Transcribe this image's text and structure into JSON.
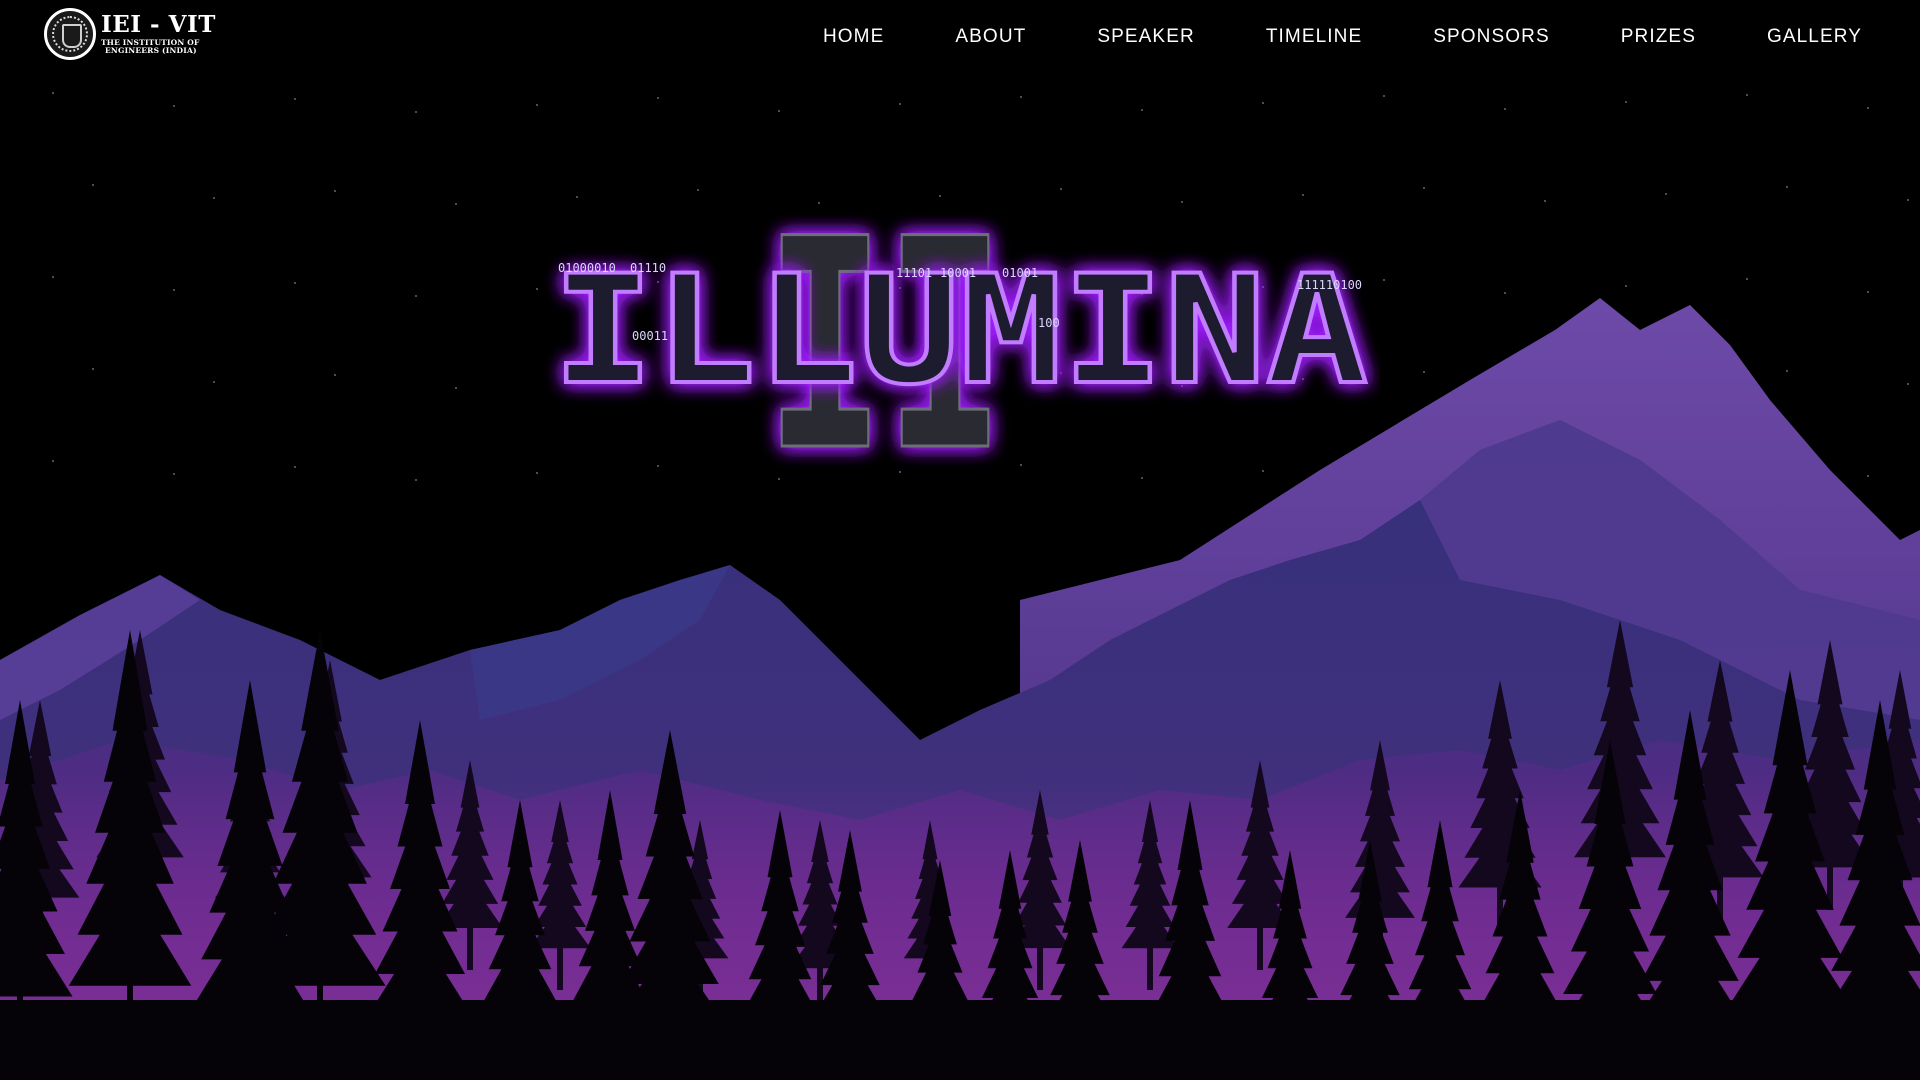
{
  "logo": {
    "title": "IEI - VIT",
    "subtitle_line1": "THE INSTITUTION OF",
    "subtitle_line2": "ENGINEERS (INDIA)"
  },
  "nav": {
    "items": [
      "HOME",
      "ABOUT",
      "SPEAKER",
      "TIMELINE",
      "SPONSORS",
      "PRIZES",
      "GALLERY"
    ]
  },
  "hero": {
    "title": "ILLUMINA",
    "title_overlay": "II",
    "binary_snippets": [
      "01000010",
      "01110",
      "11101",
      "10001",
      "01001",
      "111110100",
      "00011",
      "100"
    ]
  },
  "colors": {
    "background": "#000000",
    "glow": "#a020ff",
    "title_fill": "#1c1c2e",
    "binary_text": "#9b8cff",
    "mountain_far": "#5a3a95",
    "mountain_mid": "#3b2f7a",
    "forest": "#050308"
  },
  "icons": {
    "logo_seal": "iei-seal-icon"
  }
}
